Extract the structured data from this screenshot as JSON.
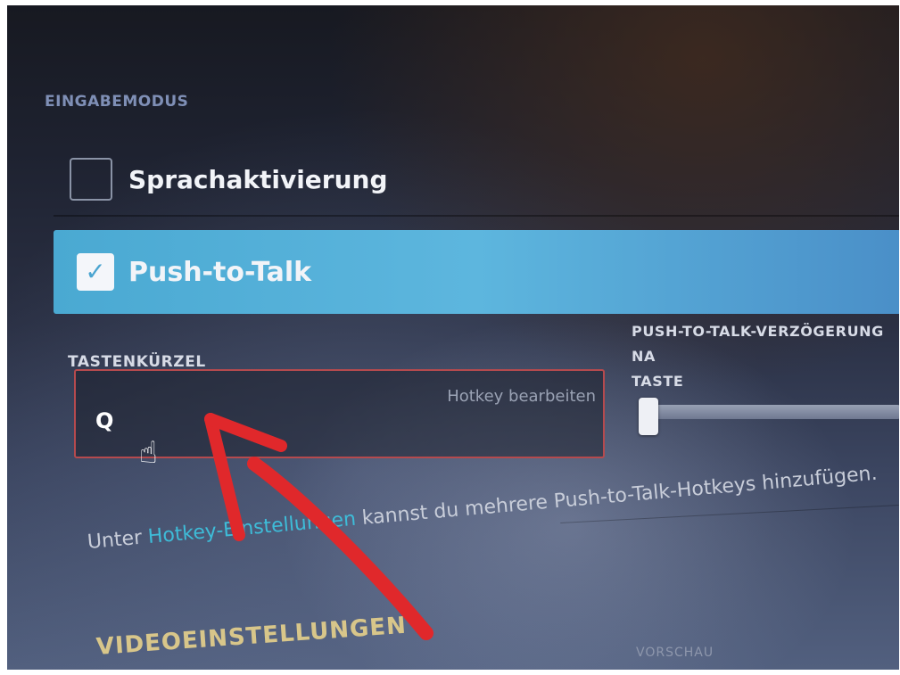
{
  "input_mode": {
    "title": "EINGABEMODUS",
    "options": [
      {
        "label": "Sprachaktivierung",
        "checked": false
      },
      {
        "label": "Push-to-Talk",
        "checked": true
      }
    ]
  },
  "shortcut": {
    "label": "TASTENKÜRZEL",
    "value": "Q",
    "edit_label": "Hotkey bearbeiten"
  },
  "delay": {
    "label": "PUSH-TO-TALK-VERZÖGERUNG NA\nTASTE",
    "level": 0.0
  },
  "hint": {
    "prefix": "Unter ",
    "link": "Hotkey-Einstellungen",
    "suffix": " kannst du mehrere Push-to-Talk-Hotkeys hinzufügen."
  },
  "video": {
    "title": "VIDEOEINSTELLUNGEN",
    "preview_label": "VORSCHAU"
  },
  "colors": {
    "accent": "#4aa9d2",
    "link": "#3ebcd8",
    "annotation": "#e0282b",
    "hotkey_border": "#b54a4e"
  },
  "icons": {
    "cursor": "hand-pointer-icon",
    "check": "checkmark-icon",
    "annotation": "red-arrow-annotation"
  }
}
